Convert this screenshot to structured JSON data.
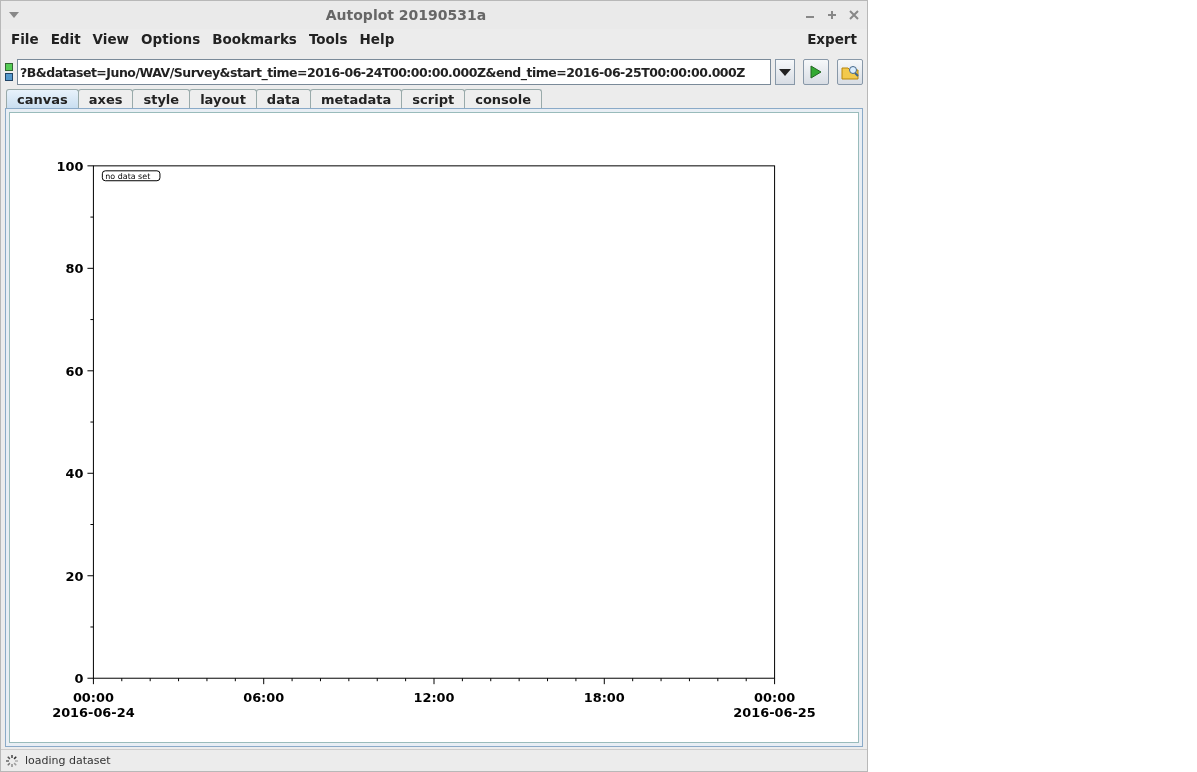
{
  "window": {
    "title": "Autoplot 20190531a"
  },
  "menu": [
    "File",
    "Edit",
    "View",
    "Options",
    "Bookmarks",
    "Tools",
    "Help"
  ],
  "menu_right": "Expert",
  "address": {
    "value": "?B&dataset=Juno/WAV/Survey&start_time=2016-06-24T00:00:00.000Z&end_time=2016-06-25T00:00:00.000Z"
  },
  "tabs": [
    {
      "label": "canvas",
      "selected": true
    },
    {
      "label": "axes",
      "selected": false
    },
    {
      "label": "style",
      "selected": false
    },
    {
      "label": "layout",
      "selected": false
    },
    {
      "label": "data",
      "selected": false
    },
    {
      "label": "metadata",
      "selected": false
    },
    {
      "label": "script",
      "selected": false
    },
    {
      "label": "console",
      "selected": false
    }
  ],
  "canvas": {
    "chart_data": {
      "type": "line",
      "xlim": [
        0,
        24
      ],
      "ylim": [
        0,
        100
      ],
      "xticks": [
        {
          "value": 0,
          "label": "00:00\n2016-06-24"
        },
        {
          "value": 6,
          "label": "06:00"
        },
        {
          "value": 12,
          "label": "12:00"
        },
        {
          "value": 18,
          "label": "18:00"
        },
        {
          "value": 24,
          "label": "00:00\n2016-06-25"
        }
      ],
      "yticks": [
        0,
        20,
        40,
        60,
        80,
        100
      ],
      "annotations": [
        "no data set"
      ]
    }
  },
  "status_bar": {
    "text": "loading dataset"
  }
}
